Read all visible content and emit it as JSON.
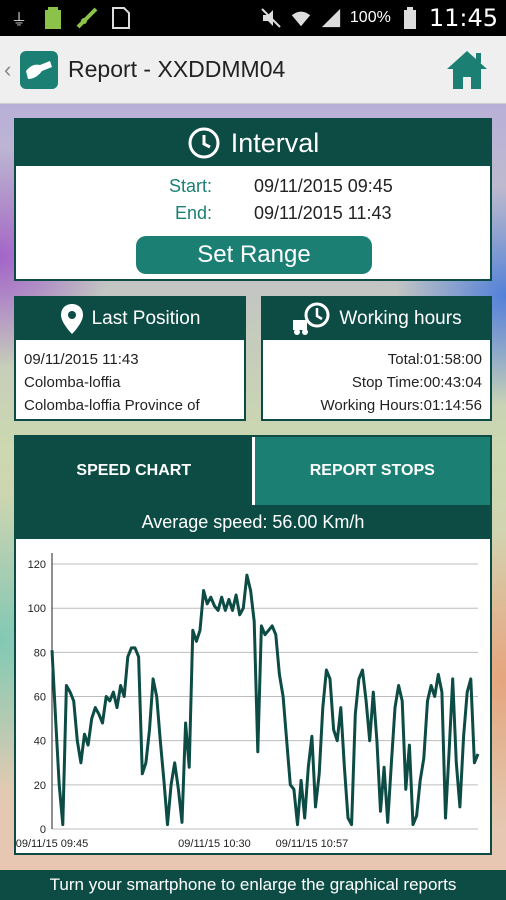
{
  "status_bar": {
    "icons": [
      "usb-icon",
      "battery-full-icon",
      "gps-icon",
      "file-icon",
      "mute-icon",
      "wifi-icon",
      "signal-icon"
    ],
    "battery": "100%",
    "time": "11:45"
  },
  "action_bar": {
    "title": "Report - XXDDMM04"
  },
  "interval": {
    "title": "Interval",
    "start_label": "Start:",
    "start_value": "09/11/2015 09:45",
    "end_label": "End:",
    "end_value": "09/11/2015 11:43",
    "button": "Set Range"
  },
  "last_position": {
    "title": "Last Position",
    "lines": [
      "09/11/2015 11:43",
      "Colomba-loffia",
      "Colomba-loffia Province of"
    ]
  },
  "working_hours": {
    "title": "Working hours",
    "lines": [
      "Total:01:58:00",
      "Stop Time:00:43:04",
      "Working Hours:01:14:56"
    ]
  },
  "tabs": {
    "speed": "SPEED CHART",
    "stops": "REPORT STOPS"
  },
  "average_speed": "Average speed: 56.00 Km/h",
  "footer": "Turn your smartphone to enlarge the graphical reports",
  "colors": {
    "primary_dark": "#0d4c45",
    "primary": "#1c7f74"
  },
  "chart_data": {
    "type": "line",
    "ylim": [
      0,
      125
    ],
    "yticks": [
      0,
      20,
      40,
      60,
      80,
      100,
      120
    ],
    "xtick_labels": [
      "09/11/15 09:45",
      "09/11/15 10:30",
      "09/11/15 10:57"
    ],
    "x_minutes": [
      0,
      1,
      2,
      3,
      4,
      5,
      6,
      7,
      8,
      9,
      10,
      11,
      12,
      13,
      14,
      15,
      16,
      17,
      18,
      19,
      20,
      21,
      22,
      23,
      24,
      25,
      26,
      27,
      28,
      29,
      30,
      31,
      32,
      33,
      34,
      35,
      36,
      37,
      38,
      39,
      40,
      41,
      42,
      43,
      44,
      45,
      46,
      47,
      48,
      49,
      50,
      51,
      52,
      53,
      54,
      55,
      56,
      57,
      58,
      59,
      60,
      61,
      62,
      63,
      64,
      65,
      66,
      67,
      68,
      69,
      70,
      71,
      72,
      73,
      74,
      75,
      76,
      77,
      78,
      79,
      80,
      81,
      82,
      83,
      84,
      85,
      86,
      87,
      88,
      89,
      90,
      91,
      92,
      93,
      94,
      95,
      96,
      97,
      98,
      99,
      100,
      101,
      102,
      103,
      104,
      105,
      106,
      107,
      108,
      109,
      110,
      111,
      112,
      113,
      114,
      115,
      116,
      117,
      118
    ],
    "speed": [
      81,
      50,
      20,
      2,
      65,
      62,
      58,
      40,
      30,
      43,
      38,
      50,
      55,
      52,
      48,
      60,
      58,
      62,
      55,
      65,
      60,
      78,
      82,
      82,
      78,
      25,
      30,
      45,
      68,
      60,
      40,
      22,
      2,
      20,
      30,
      18,
      3,
      48,
      28,
      90,
      85,
      90,
      108,
      102,
      105,
      101,
      99,
      105,
      99,
      104,
      99,
      106,
      97,
      100,
      115,
      108,
      94,
      35,
      92,
      88,
      90,
      92,
      88,
      70,
      60,
      40,
      20,
      18,
      2,
      22,
      5,
      28,
      42,
      10,
      25,
      55,
      72,
      68,
      45,
      40,
      55,
      28,
      5,
      2,
      52,
      68,
      72,
      58,
      40,
      62,
      40,
      8,
      28,
      3,
      30,
      55,
      65,
      58,
      18,
      38,
      2,
      6,
      22,
      32,
      58,
      65,
      60,
      70,
      62,
      5,
      35,
      68,
      30,
      10,
      42,
      62,
      68,
      30,
      34
    ]
  }
}
